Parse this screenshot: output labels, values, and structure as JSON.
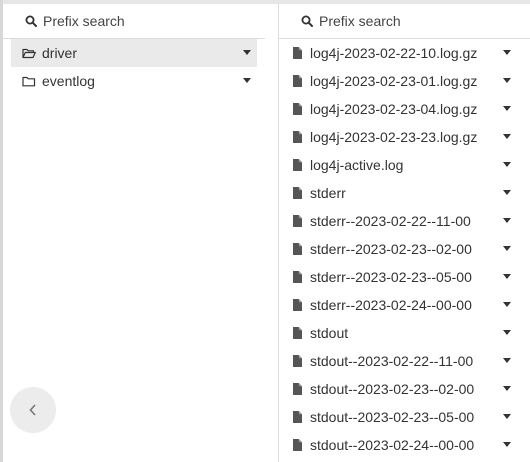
{
  "left_pane": {
    "search_placeholder": "Prefix search",
    "items": [
      {
        "label": "driver",
        "icon": "folder-open-icon",
        "selected": true
      },
      {
        "label": "eventlog",
        "icon": "folder-icon",
        "selected": false
      }
    ]
  },
  "right_pane": {
    "search_placeholder": "Prefix search",
    "items": [
      {
        "label": "log4j-2023-02-22-10.log.gz",
        "icon": "file-icon"
      },
      {
        "label": "log4j-2023-02-23-01.log.gz",
        "icon": "file-icon"
      },
      {
        "label": "log4j-2023-02-23-04.log.gz",
        "icon": "file-icon"
      },
      {
        "label": "log4j-2023-02-23-23.log.gz",
        "icon": "file-icon"
      },
      {
        "label": "log4j-active.log",
        "icon": "file-icon"
      },
      {
        "label": "stderr",
        "icon": "file-icon"
      },
      {
        "label": "stderr--2023-02-22--11-00",
        "icon": "file-icon"
      },
      {
        "label": "stderr--2023-02-23--02-00",
        "icon": "file-icon"
      },
      {
        "label": "stderr--2023-02-23--05-00",
        "icon": "file-icon"
      },
      {
        "label": "stderr--2023-02-24--00-00",
        "icon": "file-icon"
      },
      {
        "label": "stdout",
        "icon": "file-icon"
      },
      {
        "label": "stdout--2023-02-22--11-00",
        "icon": "file-icon"
      },
      {
        "label": "stdout--2023-02-23--02-00",
        "icon": "file-icon"
      },
      {
        "label": "stdout--2023-02-23--05-00",
        "icon": "file-icon"
      },
      {
        "label": "stdout--2023-02-24--00-00",
        "icon": "file-icon"
      }
    ]
  },
  "nav": {
    "back_icon": "chevron-left-icon"
  },
  "colors": {
    "selected_row": "#eaeaea",
    "text": "#333333",
    "divider": "#dcdcdc"
  }
}
